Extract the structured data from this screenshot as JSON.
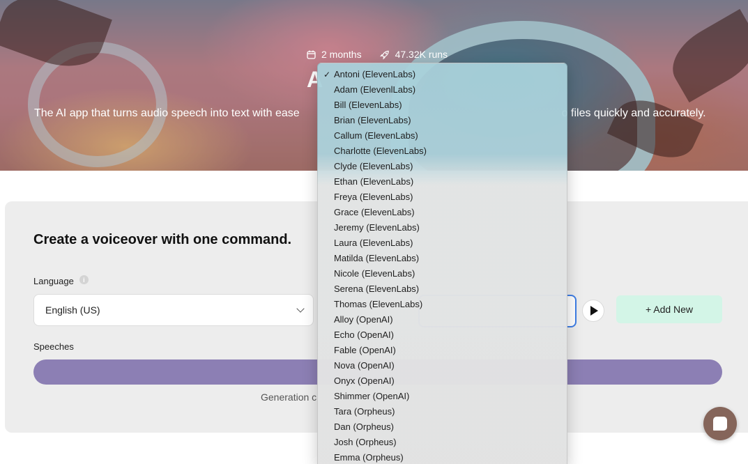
{
  "hero": {
    "age": "2 months",
    "runs": "47.32K runs",
    "title_visible": "A",
    "subtitle_left": "The AI app that turns audio speech into text with ease",
    "subtitle_right": "o files quickly and accurately."
  },
  "card": {
    "title": "Create a voiceover with one command.",
    "language_label": "Language",
    "language_value": "English (US)",
    "add_new_label": "+ Add New",
    "speeches_label": "Speeches",
    "generation_note": "Generation c"
  },
  "voice_dropdown": {
    "selected": "Antoni (ElevenLabs)",
    "options": [
      "Antoni (ElevenLabs)",
      "Adam (ElevenlLabs)",
      "Bill (ElevenLabs)",
      "Brian (ElevenLabs)",
      "Callum (ElevenLabs)",
      "Charlotte (ElevenLabs)",
      "Clyde (ElevenLabs)",
      "Ethan (ElevenLabs)",
      "Freya (ElevenLabs)",
      "Grace (ElevenLabs)",
      "Jeremy (ElevenLabs)",
      "Laura (ElevenLabs)",
      "Matilda (ElevenLabs)",
      "Nicole (ElevenLabs)",
      "Serena (ElevenLabs)",
      "Thomas (ElevenLabs)",
      "Alloy (OpenAI)",
      "Echo (OpenAI)",
      "Fable (OpenAI)",
      "Nova (OpenAI)",
      "Onyx (OpenAI)",
      "Shimmer (OpenAI)",
      "Tara (Orpheus)",
      "Dan (Orpheus)",
      "Josh (Orpheus)",
      "Emma (Orpheus)"
    ]
  },
  "icons": {
    "age": "calendar-icon",
    "runs": "rocket-icon",
    "info": "info-icon",
    "play": "play-icon",
    "chat": "chat-icon",
    "check": "checkmark-icon"
  },
  "colors": {
    "generate_button": "#8c7fb4",
    "add_new_button": "#d3f5e7",
    "voice_focus_border": "#3e7ee6",
    "chat_button": "#85655a"
  }
}
